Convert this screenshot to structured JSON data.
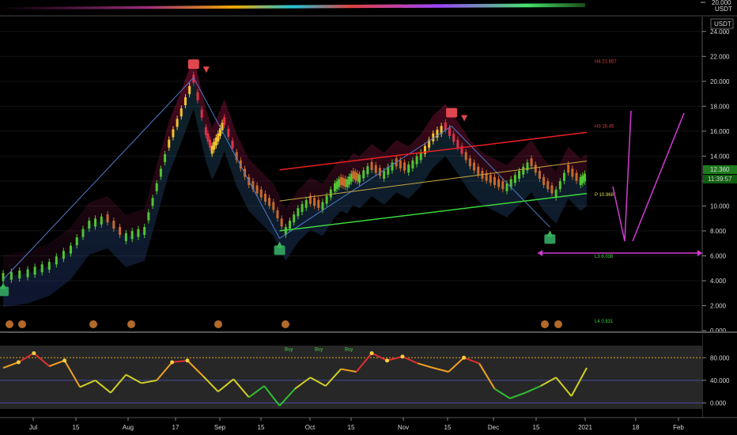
{
  "chart_data": {
    "type": "line",
    "instrument_unit": "USDT",
    "top_axis": {
      "label": "20.000",
      "unit": "USDT"
    },
    "price_axis": {
      "unit": "USDT",
      "ylim": [
        0,
        25
      ],
      "ticks": [
        "0.000",
        "2.000",
        "4.000",
        "6.000",
        "8.000",
        "10.000",
        "12.000",
        "14.000",
        "16.000",
        "18.000",
        "20.000",
        "22.000",
        "24.000"
      ],
      "last_price": "12.360",
      "countdown": "11:39:57"
    },
    "x_ticks": [
      "Jul",
      "15",
      "Aug",
      "17",
      "Sep",
      "15",
      "Oct",
      "15",
      "Nov",
      "15",
      "Dec",
      "15",
      "2021",
      "18",
      "Feb"
    ],
    "price_series": {
      "name": "price",
      "x": [
        0,
        8,
        15,
        22,
        28,
        34,
        40,
        46,
        50,
        54,
        58,
        62,
        66,
        68,
        70,
        72,
        76,
        80,
        84,
        88,
        92,
        96,
        100,
        104,
        108,
        110,
        112,
        114,
        116,
        120,
        124,
        128,
        132,
        136,
        140,
        144,
        148,
        152,
        156,
        160,
        164,
        168,
        172,
        176,
        180,
        184,
        188,
        190
      ],
      "y": [
        4.3,
        4.6,
        5.2,
        6.5,
        8.5,
        9.0,
        7.5,
        8.0,
        11.5,
        15.0,
        17.5,
        20.2,
        16.0,
        14.5,
        15.5,
        16.8,
        14.0,
        12.0,
        11.0,
        10.0,
        8.0,
        9.5,
        10.5,
        10.0,
        11.5,
        12.0,
        11.8,
        12.5,
        12.2,
        13.2,
        12.5,
        13.5,
        13.0,
        14.0,
        15.5,
        16.4,
        15.0,
        13.5,
        12.5,
        12.0,
        11.5,
        12.5,
        13.5,
        12.0,
        11.0,
        13.0,
        12.0,
        12.4
      ]
    },
    "zigzag": {
      "x": [
        0,
        62,
        90,
        146,
        178
      ],
      "y": [
        4.1,
        20.3,
        7.4,
        16.4,
        8.3
      ]
    },
    "channel": {
      "upper": {
        "x": [
          90,
          190
        ],
        "y": [
          12.9,
          15.9
        ]
      },
      "middle": {
        "x": [
          90,
          190
        ],
        "y": [
          10.4,
          13.6
        ]
      },
      "lower": {
        "x": [
          90,
          190
        ],
        "y": [
          8.0,
          11.0
        ]
      }
    },
    "pivot_levels": [
      {
        "label": "H4 21.657",
        "value": 21.657,
        "color": "#e23b3b"
      },
      {
        "label": "H3 16.45",
        "value": 16.45,
        "color": "#e23b3b"
      },
      {
        "label": "P 10.968",
        "value": 10.968,
        "color": "#dddd55"
      },
      {
        "label": "L3 6.038",
        "value": 6.038,
        "color": "#3bd13b"
      },
      {
        "label": "L4 0.831",
        "value": 0.831,
        "color": "#3bd13b"
      }
    ],
    "oscillator": {
      "ticks": [
        "80.000",
        "40.000",
        "0.000"
      ],
      "levels": [
        80,
        40,
        0
      ],
      "ylim": [
        -12,
        100
      ],
      "x": [
        0,
        5,
        10,
        15,
        20,
        25,
        30,
        35,
        40,
        45,
        50,
        55,
        60,
        65,
        70,
        75,
        80,
        85,
        90,
        95,
        100,
        105,
        110,
        115,
        120,
        125,
        130,
        135,
        140,
        145,
        150,
        155,
        160,
        165,
        170,
        175,
        180,
        185,
        190
      ],
      "y": [
        62,
        72,
        88,
        65,
        75,
        28,
        40,
        18,
        50,
        35,
        40,
        72,
        75,
        48,
        20,
        42,
        10,
        30,
        -5,
        25,
        45,
        30,
        60,
        55,
        88,
        75,
        82,
        70,
        62,
        55,
        80,
        70,
        25,
        8,
        18,
        30,
        45,
        12,
        62
      ],
      "labels": [
        "Buy",
        "Buy",
        "Buy"
      ]
    }
  }
}
